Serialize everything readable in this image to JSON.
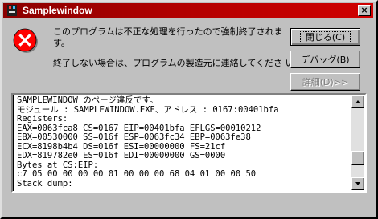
{
  "window": {
    "title": "Samplewindow",
    "close_glyph": "×"
  },
  "message": {
    "line1": "このプログラムは不正な処理を行ったので強制終了されま",
    "line2": "す。",
    "line3": "終了しない場合は、プログラムの製造元に連絡してくださ い。"
  },
  "buttons": {
    "close_label": "閉じる(C)",
    "debug_label": "デバッグ(B)",
    "details_label": "詳細(D)>>"
  },
  "details": {
    "lines": [
      "SAMPLEWINDOW のページ違反です。",
      "モジュール : SAMPLEWINDOW.EXE、アドレス : 0167:00401bfa",
      "Registers:",
      "EAX=0063fca8 CS=0167 EIP=00401bfa EFLGS=00010212",
      "EBX=00530000 SS=016f ESP=0063fc34 EBP=0063fe38",
      "ECX=8198b4b4 DS=016f ESI=00000000 FS=21cf",
      "EDX=819782e0 ES=016f EDI=00000000 GS=0000",
      "Bytes at CS:EIP:",
      "c7 05 00 00 00 00 01 00 00 00 68 04 01 00 00 50",
      "Stack dump:"
    ],
    "scroll_position": 0.78
  },
  "icons": {
    "title": "app-bug-icon",
    "error": "error-x-icon",
    "error_color": "#ff0000"
  },
  "colors": {
    "titlebar": "#b00000",
    "face": "#c0c0c0"
  }
}
